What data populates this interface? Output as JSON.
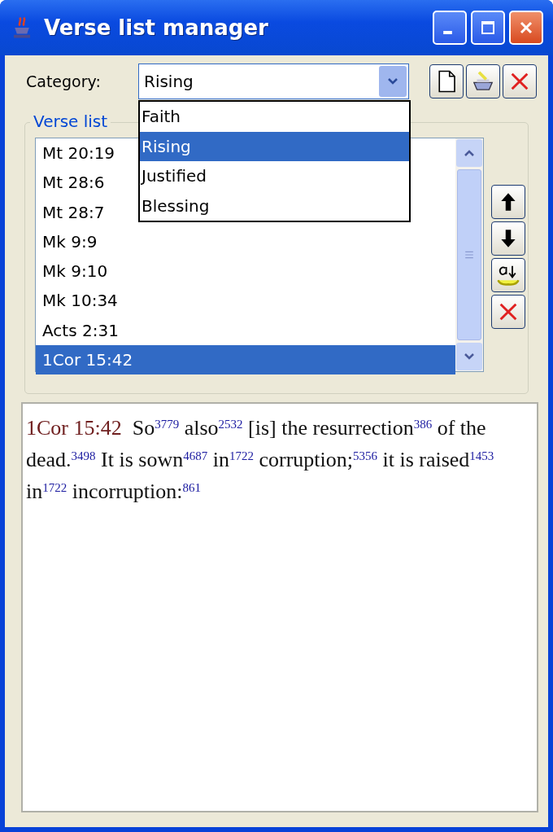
{
  "window": {
    "title": "Verse list manager"
  },
  "category": {
    "label": "Category:",
    "value": "Rising",
    "expanded": true,
    "options": [
      {
        "label": "Faith",
        "selected": false
      },
      {
        "label": "Rising",
        "selected": true
      },
      {
        "label": "Justified",
        "selected": false
      },
      {
        "label": "Blessing",
        "selected": false
      }
    ]
  },
  "verse_list": {
    "title": "Verse list",
    "items": [
      {
        "label": "Mt 20:19",
        "selected": false
      },
      {
        "label": "Mt 28:6",
        "selected": false
      },
      {
        "label": "Mt 28:7",
        "selected": false
      },
      {
        "label": "Mk 9:9",
        "selected": false
      },
      {
        "label": "Mk 9:10",
        "selected": false
      },
      {
        "label": "Mk 10:34",
        "selected": false
      },
      {
        "label": "Acts 2:31",
        "selected": false
      },
      {
        "label": "1Cor 15:42",
        "selected": true
      }
    ]
  },
  "verse": {
    "reference": "1Cor 15:42",
    "tokens": [
      {
        "text": "So",
        "number": "3779"
      },
      {
        "text": "also",
        "number": "2532"
      },
      {
        "text": "[is] the"
      },
      {
        "text": "resurrection",
        "number": "386"
      },
      {
        "text": "of the dead.",
        "number": "3498"
      },
      {
        "text": "It is sown",
        "number": "4687"
      },
      {
        "text": "in",
        "number": "1722"
      },
      {
        "text": "corruption;",
        "number": "5356"
      },
      {
        "text": "it is raised",
        "number": "1453"
      },
      {
        "text": "in",
        "number": "1722"
      },
      {
        "text": "incorruption:",
        "number": "861"
      }
    ]
  }
}
